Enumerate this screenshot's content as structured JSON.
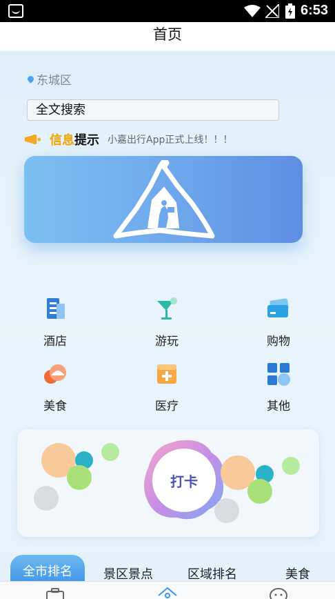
{
  "status_bar": {
    "time": "6:53"
  },
  "header": {
    "title": "首页"
  },
  "location": {
    "label": "东城区"
  },
  "search": {
    "placeholder": "全文搜索"
  },
  "notice": {
    "label_part1": "信息",
    "label_part2": "提示",
    "message": "小嘉出行App正式上线！！！"
  },
  "categories": [
    {
      "label": "酒店",
      "icon": "hotel-icon"
    },
    {
      "label": "游玩",
      "icon": "cocktail-icon"
    },
    {
      "label": "购物",
      "icon": "card-icon"
    },
    {
      "label": "美食",
      "icon": "food-icon"
    },
    {
      "label": "医疗",
      "icon": "medical-icon"
    },
    {
      "label": "其他",
      "icon": "grid-icon"
    }
  ],
  "checkin": {
    "label": "打卡"
  },
  "tabs": [
    {
      "label": "全市排名",
      "active": true
    },
    {
      "label": "景区景点",
      "active": false
    },
    {
      "label": "区域排名",
      "active": false
    },
    {
      "label": "美食",
      "active": false
    }
  ],
  "bottom_nav": [
    "bag-icon",
    "home-icon",
    "chat-icon"
  ]
}
